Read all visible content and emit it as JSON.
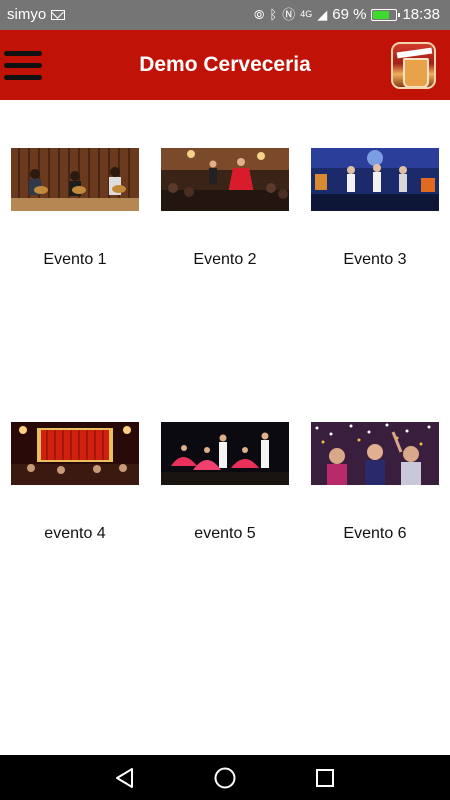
{
  "status_bar": {
    "carrier": "simyo",
    "network_type": "4G",
    "battery_percent_text": "69 %",
    "battery_level": 0.69,
    "time": "18:38",
    "icons": [
      "mail-icon",
      "hotspot-icon",
      "bluetooth-icon",
      "nfc-icon",
      "signal-icon",
      "battery-icon"
    ]
  },
  "app_bar": {
    "title": "Demo Cerveceria",
    "background_color": "#c01207",
    "menu_icon": "hamburger-menu-icon",
    "logo": "app-logo"
  },
  "events": [
    {
      "label": "Evento 1",
      "image": "guitarists-on-stage"
    },
    {
      "label": "Evento 2",
      "image": "flamenco-dancer-restaurant"
    },
    {
      "label": "Evento 3",
      "image": "band-playing-club"
    },
    {
      "label": "evento 4",
      "image": "theater-stage-red-curtain"
    },
    {
      "label": "evento 5",
      "image": "folk-dancers-red-skirts"
    },
    {
      "label": "Evento 6",
      "image": "party-confetti-crowd"
    }
  ],
  "nav_bar": {
    "back": "back-icon",
    "home": "home-icon",
    "recents": "recents-icon"
  }
}
